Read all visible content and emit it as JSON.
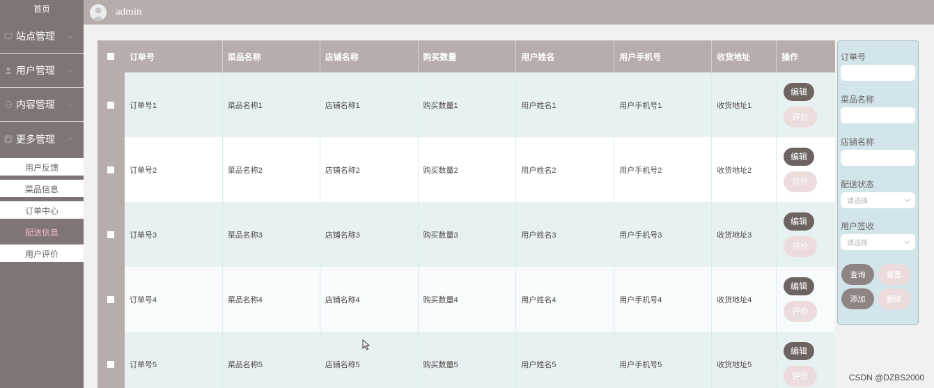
{
  "sidebar": {
    "home": "首页",
    "groups": [
      {
        "label": "站点管理",
        "icon": "monitor-icon"
      },
      {
        "label": "用户管理",
        "icon": "user-icon"
      },
      {
        "label": "内容管理",
        "icon": "content-icon"
      },
      {
        "label": "更多管理",
        "icon": "more-icon"
      }
    ],
    "subitems": [
      "用户反馈",
      "菜品信息",
      "订单中心",
      "配送信息",
      "用户评价"
    ],
    "active_subitem": "配送信息"
  },
  "header": {
    "username": "admin",
    "avatar_icon": "user-avatar-icon"
  },
  "table": {
    "columns": [
      "订单号",
      "菜品名称",
      "店铺名称",
      "购买数量",
      "用户姓名",
      "用户手机号",
      "收货地址",
      "操作"
    ],
    "rows": [
      {
        "order_no": "订单号1",
        "dish": "菜品名称1",
        "shop": "店铺名称1",
        "qty": "购买数量1",
        "name": "用户姓名1",
        "phone": "用户手机号1",
        "address": "收货地址1"
      },
      {
        "order_no": "订单号2",
        "dish": "菜品名称2",
        "shop": "店铺名称2",
        "qty": "购买数量2",
        "name": "用户姓名2",
        "phone": "用户手机号2",
        "address": "收货地址2"
      },
      {
        "order_no": "订单号3",
        "dish": "菜品名称3",
        "shop": "店铺名称3",
        "qty": "购买数量3",
        "name": "用户姓名3",
        "phone": "用户手机号3",
        "address": "收货地址3"
      },
      {
        "order_no": "订单号4",
        "dish": "菜品名称4",
        "shop": "店铺名称4",
        "qty": "购买数量4",
        "name": "用户姓名4",
        "phone": "用户手机号4",
        "address": "收货地址4"
      },
      {
        "order_no": "订单号5",
        "dish": "菜品名称5",
        "shop": "店铺名称5",
        "qty": "购买数量5",
        "name": "用户姓名5",
        "phone": "用户手机号5",
        "address": "收货地址5"
      }
    ],
    "edit_label": "编辑",
    "rate_label": "评价"
  },
  "filter": {
    "order_no_label": "订单号",
    "dish_label": "菜品名称",
    "shop_label": "店铺名称",
    "delivery_status_label": "配送状态",
    "user_sign_label": "用户签收",
    "select_placeholder": "请选择",
    "query_label": "查询",
    "reset_label": "重置",
    "add_label": "添加",
    "delete_label": "删除"
  },
  "watermark": "CSDN @DZBS2000",
  "colors": {
    "sidebar_bg": "#7f7574",
    "header_bg": "#b7aeac",
    "row_tint": "#e8f1f2",
    "active_text": "#f3b9c0",
    "edit_btn": "#6d6462",
    "rate_btn": "#ecdcdc",
    "panel_bg": "#d1e5eb"
  }
}
